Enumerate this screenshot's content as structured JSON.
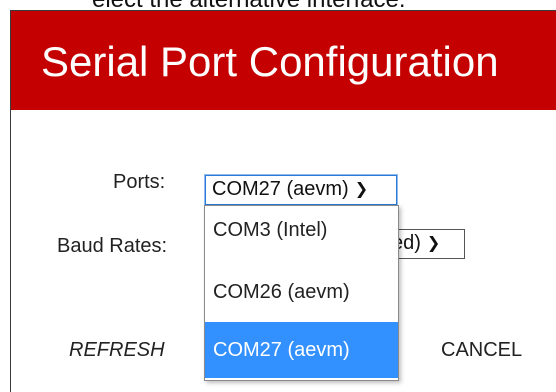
{
  "background_caption": "elect the alternative interface:",
  "dialog": {
    "title": "Serial Port Configuration",
    "accent_color": "#c40000"
  },
  "ports": {
    "label": "Ports:",
    "selected": "COM27 (aevm)",
    "options": [
      "COM3 (Intel)",
      "COM26 (aevm)",
      "COM27 (aevm)"
    ],
    "highlighted_index": 2
  },
  "baud": {
    "label": "Baud Rates:",
    "visible_value": "ed)"
  },
  "buttons": {
    "refresh": "REFRESH",
    "cancel": "CANCEL"
  },
  "icons": {
    "dropdown_arrow": "chevron-down-icon"
  }
}
